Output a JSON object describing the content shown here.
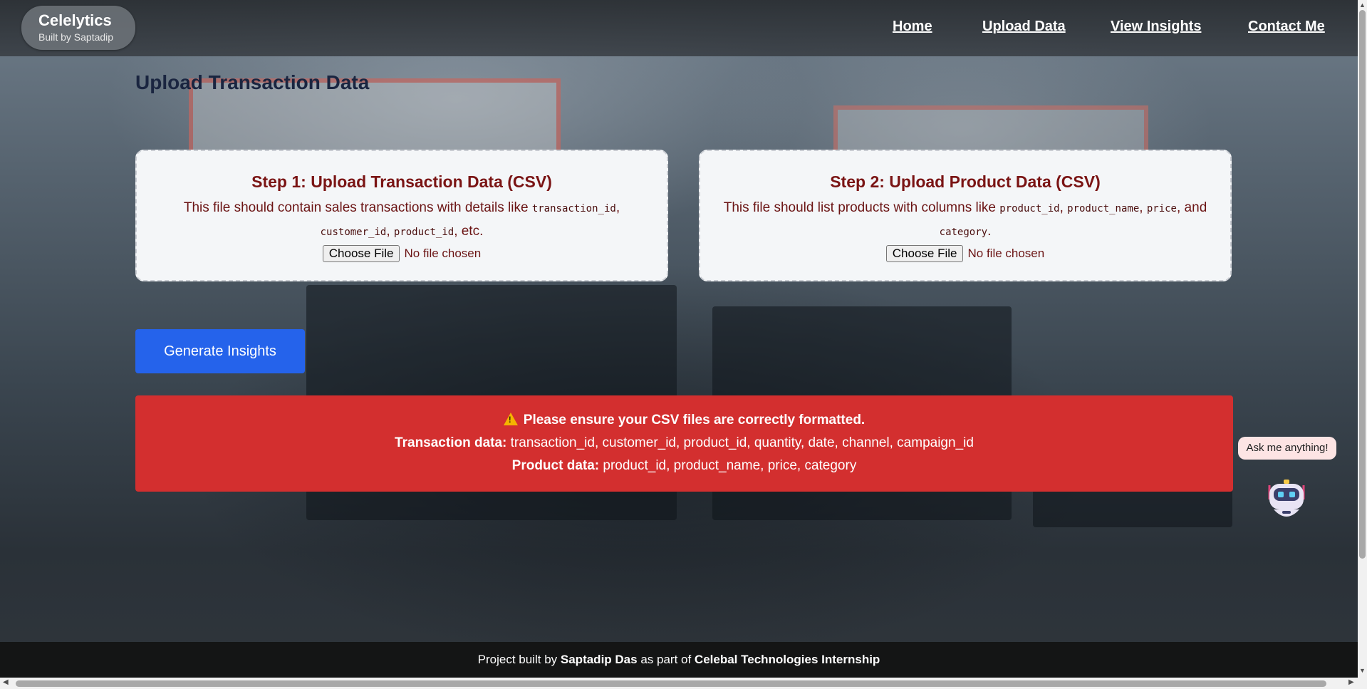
{
  "brand": {
    "title": "Celelytics",
    "subtitle": "Built by Saptadip"
  },
  "nav": {
    "home": "Home",
    "upload": "Upload Data",
    "insights": "View Insights",
    "contact": "Contact Me"
  },
  "page": {
    "title": "Upload Transaction Data"
  },
  "card1": {
    "title": "Step 1: Upload Transaction Data (CSV)",
    "desc_prefix": "This file should contain sales transactions with details like ",
    "code1": "transaction_id",
    "sep1": ", ",
    "code2": "customer_id",
    "sep2": ", ",
    "code3": "product_id",
    "desc_suffix": ", etc.",
    "file_button": "Choose File",
    "file_status": "No file chosen"
  },
  "card2": {
    "title": "Step 2: Upload Product Data (CSV)",
    "desc_prefix": "This file should list products with columns like ",
    "code1": "product_id",
    "sep1": ", ",
    "code2": "product_name",
    "sep2": ", ",
    "code3": "price",
    "sep3": ", and ",
    "code4": "category",
    "desc_suffix": ".",
    "file_button": "Choose File",
    "file_status": "No file chosen"
  },
  "generate_button": "Generate Insights",
  "alert": {
    "message": "Please ensure your CSV files are correctly formatted.",
    "transaction_label": "Transaction data:",
    "transaction_value": "transaction_id, customer_id, product_id, quantity, date, channel, campaign_id",
    "product_label": "Product data:",
    "product_value": "product_id, product_name, price, category"
  },
  "chat": {
    "bubble": "Ask me anything!"
  },
  "footer": {
    "prefix": "Project built by ",
    "author": "Saptadip Das",
    "middle": " as part of ",
    "org": "Celebal Technologies Internship"
  },
  "colors": {
    "accent": "#2563eb",
    "alert": "#d32f2f",
    "title_text": "#7a1414"
  }
}
